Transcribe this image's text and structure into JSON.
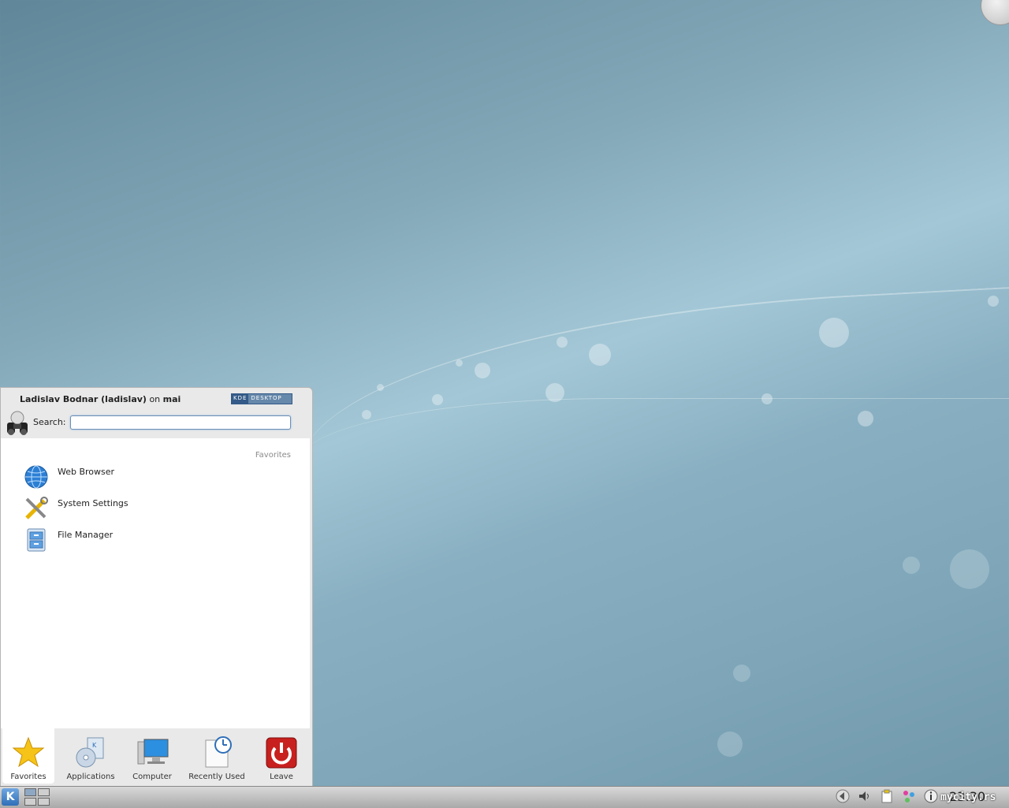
{
  "colors": {
    "accent": "#2f6fb8",
    "leave_red": "#c8201e",
    "menu_bg": "#e9e9e9"
  },
  "menu": {
    "user_name": "Ladislav Bodnar (ladislav)",
    "on_text": "on",
    "host": "mai",
    "badge_left": "KDE",
    "badge_right": "DESKTOP",
    "search": {
      "label": "Search:",
      "value": "",
      "placeholder": ""
    },
    "section_label": "Favorites",
    "favorites": [
      {
        "label": "Web Browser",
        "icon": "globe-icon"
      },
      {
        "label": "System Settings",
        "icon": "tools-icon"
      },
      {
        "label": "File Manager",
        "icon": "file-cabinet-icon"
      }
    ],
    "tabs": [
      {
        "label": "Favorites",
        "icon": "star-icon",
        "active": true
      },
      {
        "label": "Applications",
        "icon": "applications-icon"
      },
      {
        "label": "Computer",
        "icon": "computer-icon"
      },
      {
        "label": "Recently Used",
        "icon": "clock-document-icon"
      },
      {
        "label": "Leave",
        "icon": "power-icon"
      }
    ]
  },
  "taskbar": {
    "kde_button": "K",
    "clock": "23:30",
    "tray_icons": [
      "arrow-left-icon",
      "volume-icon",
      "clipboard-icon",
      "network-icon",
      "info-icon"
    ]
  },
  "watermark": "mycity.rs"
}
